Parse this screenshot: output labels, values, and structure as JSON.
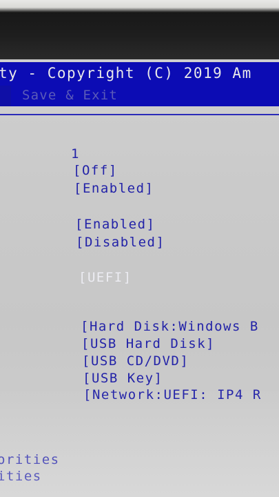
{
  "header": {
    "title": "ty - Copyright (C) 2019 Am",
    "menu_item": "Save & Exit"
  },
  "values": [
    "1",
    "[Off]",
    "[Enabled]",
    "[Enabled]",
    "[Disabled]",
    "[UEFI]",
    "[Hard Disk:Windows B",
    "[USB Hard Disk]",
    "[USB CD/DVD]",
    "[USB Key]",
    "[Network:UEFI: IP4 R"
  ],
  "left_labels": [
    "orities",
    "ities"
  ],
  "colors": {
    "title_bar": "#0c0cb4",
    "screen": "#c9c9c9",
    "value_text": "#2323a8",
    "selected_text": "#ececf2"
  }
}
